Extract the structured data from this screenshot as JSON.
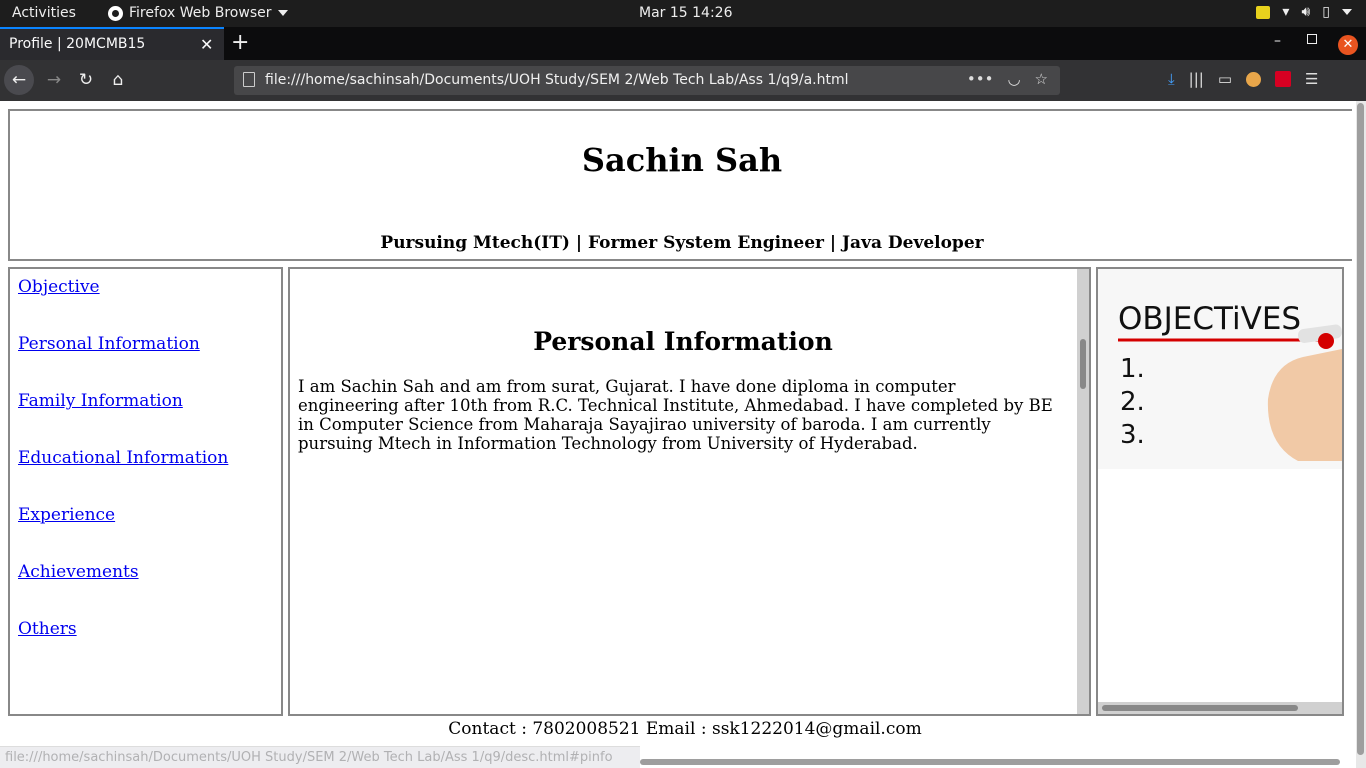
{
  "topbar": {
    "activities": "Activities",
    "app_name": "Firefox Web Browser",
    "clock": "Mar 15  14:26"
  },
  "browser": {
    "tab_title": "Profile | 20MCMB15",
    "url": "file:///home/sachinsah/Documents/UOH Study/SEM 2/Web Tech Lab/Ass 1/q9/a.html",
    "status_url": "file:///home/sachinsah/Documents/UOH Study/SEM 2/Web Tech Lab/Ass 1/q9/desc.html#pinfo"
  },
  "header": {
    "name": "Sachin Sah",
    "tagline": "Pursuing Mtech(IT) | Former System Engineer | Java Developer"
  },
  "nav": {
    "links": [
      "Objective",
      "Personal Information",
      "Family Information",
      "Educational Information",
      "Experience",
      "Achievements",
      "Others"
    ]
  },
  "content": {
    "title": "Personal Information",
    "text": "I am Sachin Sah and am from surat, Gujarat. I have done diploma in computer engineering after 10th from R.C. Technical Institute, Ahmedabad. I have completed by BE in Computer Science from Maharaja Sayajirao university of baroda. I am currently pursuing Mtech in Information Technology from University of Hyderabad."
  },
  "image": {
    "heading": "OBJECTiVES",
    "items": [
      "1.",
      "2.",
      "3."
    ],
    "underline_color": "#d40000"
  },
  "footer": {
    "contact": "Contact : 7802008521 Email : ssk1222014@gmail.com"
  },
  "colors": {
    "link": "#0000ee",
    "tab_accent": "#0a84ff",
    "close_button": "#e95420"
  }
}
